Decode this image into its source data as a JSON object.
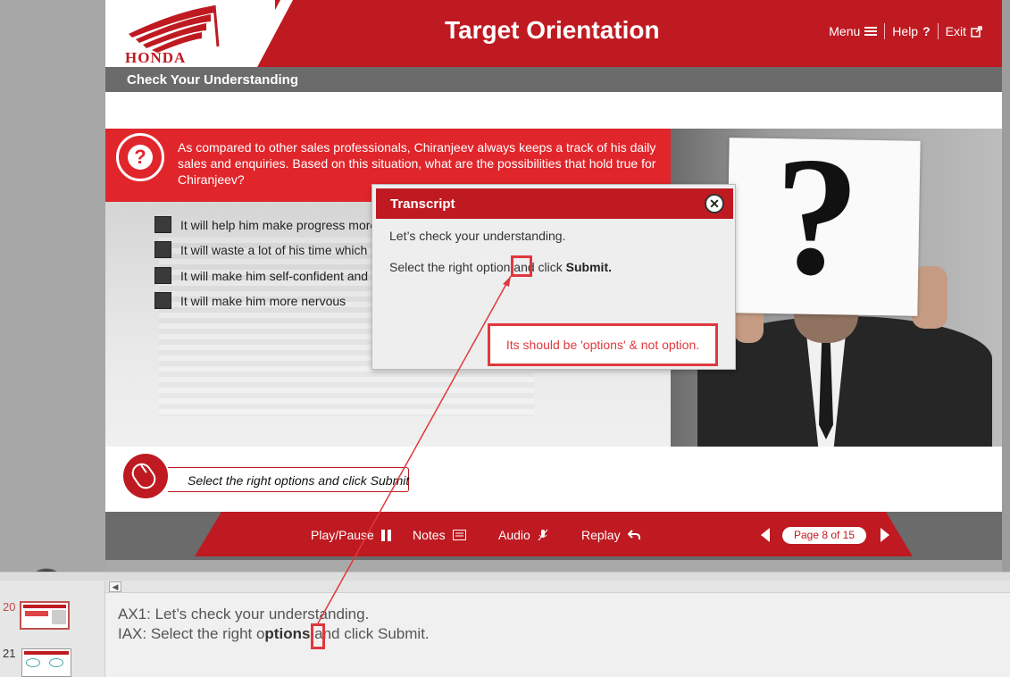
{
  "header": {
    "brand": "HONDA",
    "title": "Target Orientation",
    "nav": {
      "menu": "Menu",
      "help": "Help",
      "exit": "Exit"
    }
  },
  "subheader": "Check Your Understanding",
  "question": {
    "text": "As compared to other sales professionals, Chiranjeev always keeps a track of his daily sales and enquiries. Based on this situation, what are the possibilities that hold true for Chiranjeev?",
    "options": [
      "It will help him make progress more",
      "It will waste a lot of his time which h",
      "It will make him self-confident and",
      "It will make him more nervous"
    ]
  },
  "instruction": "Select the right options and click Submit",
  "transcript": {
    "title": "Transcript",
    "line1": "Let’s check your understanding.",
    "line2_prefix": "Select the right option and click ",
    "line2_bold": "Submit."
  },
  "annotation": {
    "note": "Its should be 'options' & not option."
  },
  "footer": {
    "play_pause": "Play/Pause",
    "notes": "Notes",
    "audio": "Audio",
    "replay": "Replay",
    "page": "Page 8 of 15"
  },
  "thumbnails": [
    {
      "number": "20",
      "selected": true
    },
    {
      "number": "21",
      "selected": false
    }
  ],
  "notes": {
    "line1": "AX1: Let’s check your understanding.",
    "line2_prefix": "IAX: Select the right o",
    "line2_bold": "ptions",
    "line2_suffix": " and click Submit."
  },
  "colors": {
    "brand_red": "#bf1a21",
    "question_red": "#e1262b",
    "annotation_red": "#e0383d",
    "grey_bar": "#6b6b6b"
  }
}
